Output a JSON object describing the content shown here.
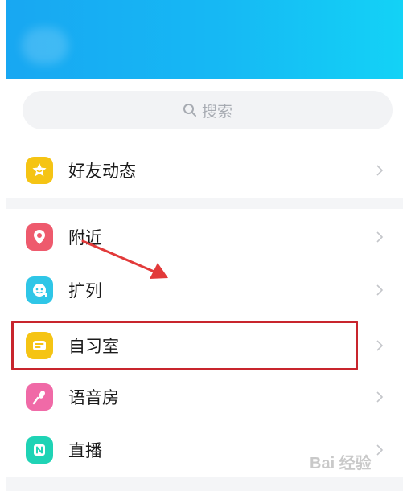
{
  "search": {
    "placeholder": "搜索"
  },
  "menu": [
    {
      "id": "friends",
      "label": "好友动态",
      "icon": "star-icon",
      "color": "#f5c414"
    },
    {
      "id": "nearby",
      "label": "附近",
      "icon": "location-pin-icon",
      "color": "#ee5a6d"
    },
    {
      "id": "expand",
      "label": "扩列",
      "icon": "chat-face-icon",
      "color": "#2fc6e7"
    },
    {
      "id": "study",
      "label": "自习室",
      "icon": "study-room-icon",
      "color": "#f5c414"
    },
    {
      "id": "voice",
      "label": "语音房",
      "icon": "microphone-icon",
      "color": "#f06aa7"
    },
    {
      "id": "live",
      "label": "直播",
      "icon": "live-icon",
      "color": "#1fd3b5"
    }
  ],
  "colors": {
    "header_start": "#18a7f2",
    "header_end": "#13d2f6",
    "highlight_box": "#c8252d",
    "arrow": "#e23a3a"
  },
  "watermark": {
    "text": "Bai 经验"
  }
}
